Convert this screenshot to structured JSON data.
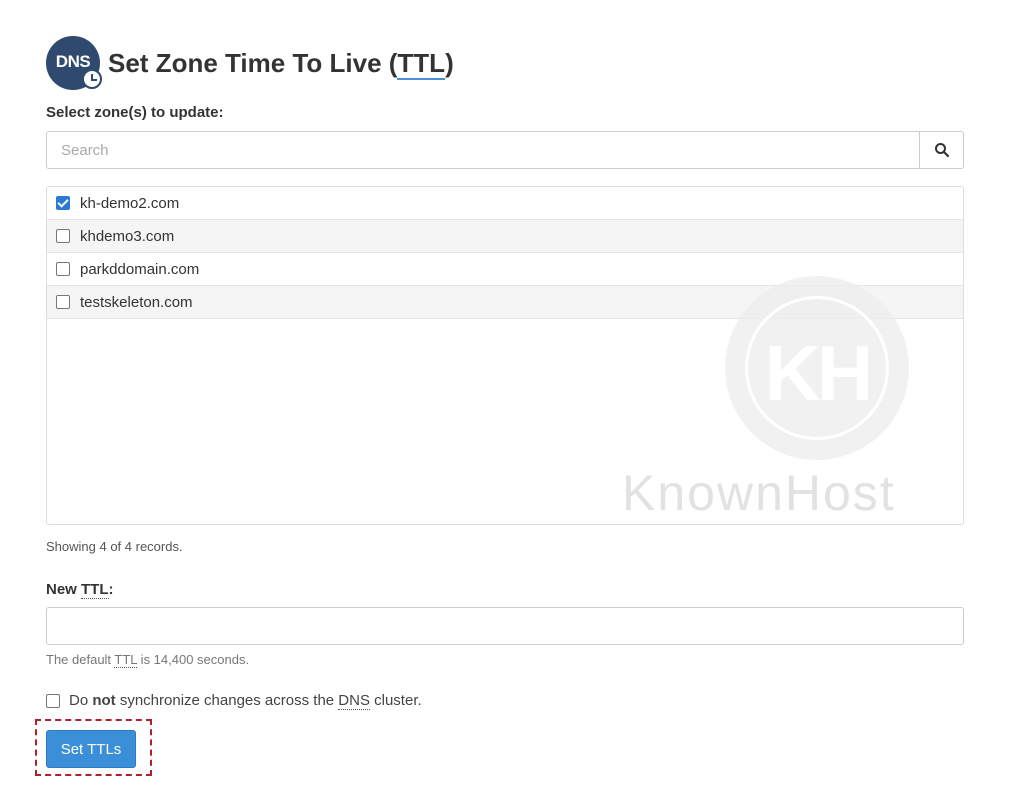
{
  "header": {
    "icon_text": "DNS",
    "title_prefix": "Set Zone Time To Live (",
    "title_abbr": "TTL",
    "title_suffix": ")"
  },
  "zones": {
    "label": "Select zone(s) to update:",
    "search_placeholder": "Search",
    "items": [
      {
        "name": "kh-demo2.com",
        "checked": true
      },
      {
        "name": "khdemo3.com",
        "checked": false
      },
      {
        "name": "parkddomain.com",
        "checked": false
      },
      {
        "name": "testskeleton.com",
        "checked": false
      }
    ],
    "showing_text": "Showing 4 of 4 records."
  },
  "ttl": {
    "label_prefix": "New ",
    "label_abbr": "TTL",
    "label_suffix": ":",
    "value": "",
    "help_prefix": "The default ",
    "help_abbr": "TTL",
    "help_suffix": " is 14,400 seconds."
  },
  "sync": {
    "checked": false,
    "text_1": "Do ",
    "text_bold": "not",
    "text_2": " synchronize changes across the ",
    "text_abbr": "DNS",
    "text_3": " cluster."
  },
  "submit_label": "Set TTLs",
  "watermark": {
    "logo": "KH",
    "text": "KnownHost"
  },
  "colors": {
    "primary": "#3a8fd8",
    "highlight": "#b0202a",
    "icon_bg": "#2f4a6e"
  }
}
